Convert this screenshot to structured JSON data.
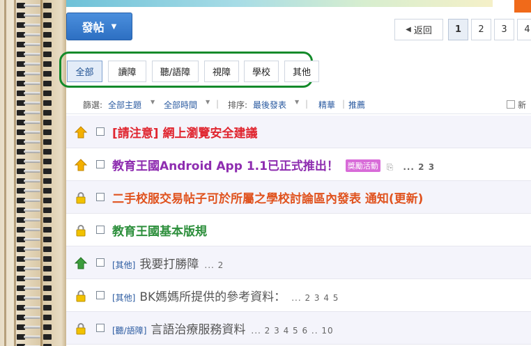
{
  "toolbar": {
    "post_label": "發帖"
  },
  "pagination": {
    "back_label": "返回",
    "pages": [
      "1",
      "2",
      "3",
      "4"
    ]
  },
  "categories": [
    "全部",
    "讀障",
    "聽/語障",
    "視障",
    "學校",
    "其他"
  ],
  "filters": {
    "filter_label": "篩選:",
    "topic": "全部主題",
    "time": "全部時間",
    "sort_label": "排序:",
    "sort": "最後發表",
    "digest": "精華",
    "recommend": "推薦",
    "new_window": "新"
  },
  "threads": [
    {
      "icon": "announcement-icon",
      "title": "[請注意] 網上瀏覽安全建議"
    },
    {
      "icon": "announcement-icon",
      "title": "教育王國Android App 1.1已正式推出！",
      "badge": "獎勵活動",
      "pages": "... 2 3"
    },
    {
      "icon": "lock-icon",
      "title": "二手校服交易帖子可於所屬之學校討論區內發表 通知(更新)"
    },
    {
      "icon": "lock-icon",
      "title": "教育王國基本版規"
    },
    {
      "icon": "pinned-icon",
      "tag": "[其他]",
      "title": "我要打勝障",
      "pages": "... 2"
    },
    {
      "icon": "lock-icon",
      "tag": "[其他]",
      "title": "BK媽媽所提供的參考資料：",
      "pages": "... 2 3 4 5"
    },
    {
      "icon": "lock-icon",
      "tag": "[聽/語障]",
      "title": "言語治療服務資料",
      "pages": "... 2 3 4 5 6 .. 10"
    }
  ],
  "colors": {
    "accent": "#2d6fc2",
    "highlight_border": "#138a2a",
    "red": "#e0252f",
    "purple": "#8e2db0",
    "orange": "#e0531f",
    "green": "#2d8f3c"
  }
}
